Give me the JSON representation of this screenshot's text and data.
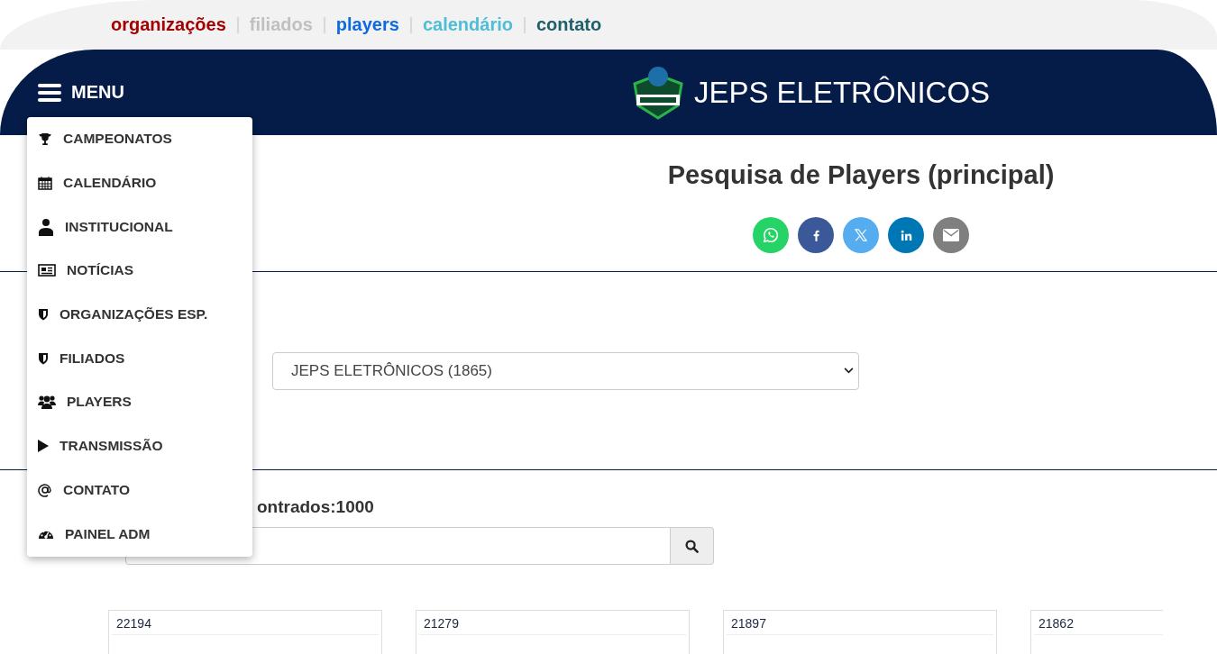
{
  "top_links": [
    {
      "label": "organizações",
      "color": "#a50000"
    },
    {
      "label": "filiados",
      "color": "#c0c0c0"
    },
    {
      "label": "players",
      "color": "#0d6ae0"
    },
    {
      "label": "calendário",
      "color": "#4fbdd6"
    },
    {
      "label": "contato",
      "color": "#1f5e6b"
    }
  ],
  "header": {
    "menu_label": "MENU",
    "site_title": "JEPS ELETRÔNICOS"
  },
  "menu": {
    "items": [
      {
        "label": "CAMPEONATOS",
        "kind": "trophy"
      },
      {
        "label": "CALENDÁRIO",
        "kind": "calendar"
      },
      {
        "label": "INSTITUCIONAL",
        "kind": "person"
      },
      {
        "label": "NOTÍCIAS",
        "kind": "news"
      },
      {
        "label": "ORGANIZAÇÕES ESP.",
        "kind": "shield"
      },
      {
        "label": "FILIADOS",
        "kind": "shield"
      },
      {
        "label": "PLAYERS",
        "kind": "users"
      },
      {
        "label": "TRANSMISSÃO",
        "kind": "play"
      },
      {
        "label": "CONTATO",
        "kind": "at"
      },
      {
        "label": "PAINEL ADM",
        "kind": "gauge"
      }
    ]
  },
  "page_title": "Pesquisa de Players (principal)",
  "share": [
    {
      "kind": "whatsapp",
      "color": "#25d366"
    },
    {
      "kind": "facebook",
      "color": "#3b5998"
    },
    {
      "kind": "x",
      "color": "#55acee"
    },
    {
      "kind": "linkedin",
      "color": "#0077b5"
    },
    {
      "kind": "email",
      "color": "#7f7f7f"
    }
  ],
  "organization_select": {
    "value": "JEPS ELETRÔNICOS (1865)"
  },
  "results_count": "ontrados:1000",
  "cards": [
    {
      "number": "22194"
    },
    {
      "number": "21279"
    },
    {
      "number": "21897"
    },
    {
      "number": "21862"
    }
  ]
}
